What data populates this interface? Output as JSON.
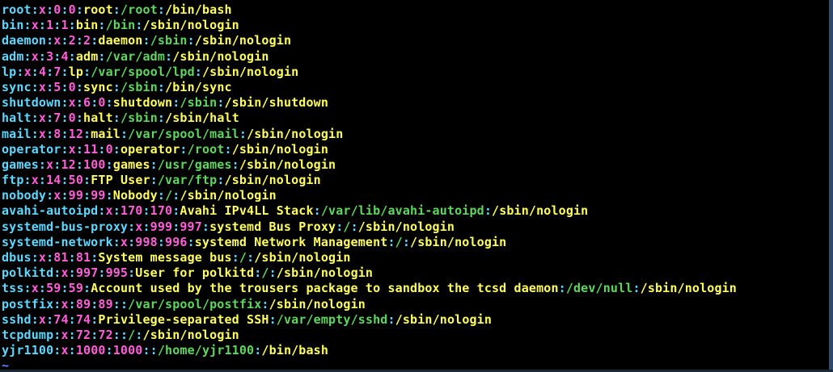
{
  "colors": {
    "background": "#000000",
    "field_user": "#5fd7ff",
    "field_x": "#ff5fd7",
    "field_uid": "#ff5fd7",
    "field_gid": "#ff5fd7",
    "field_gecos": "#ffff5f",
    "field_home": "#5fd75f",
    "field_shell": "#ffff5f",
    "separator": "#5fd7ff",
    "tilde": "#5f87ff"
  },
  "terminal": {
    "lines": [
      [
        "root",
        "x",
        "0",
        "0",
        "root",
        "/root",
        "/bin/bash"
      ],
      [
        "bin",
        "x",
        "1",
        "1",
        "bin",
        "/bin",
        "/sbin/nologin"
      ],
      [
        "daemon",
        "x",
        "2",
        "2",
        "daemon",
        "/sbin",
        "/sbin/nologin"
      ],
      [
        "adm",
        "x",
        "3",
        "4",
        "adm",
        "/var/adm",
        "/sbin/nologin"
      ],
      [
        "lp",
        "x",
        "4",
        "7",
        "lp",
        "/var/spool/lpd",
        "/sbin/nologin"
      ],
      [
        "sync",
        "x",
        "5",
        "0",
        "sync",
        "/sbin",
        "/bin/sync"
      ],
      [
        "shutdown",
        "x",
        "6",
        "0",
        "shutdown",
        "/sbin",
        "/sbin/shutdown"
      ],
      [
        "halt",
        "x",
        "7",
        "0",
        "halt",
        "/sbin",
        "/sbin/halt"
      ],
      [
        "mail",
        "x",
        "8",
        "12",
        "mail",
        "/var/spool/mail",
        "/sbin/nologin"
      ],
      [
        "operator",
        "x",
        "11",
        "0",
        "operator",
        "/root",
        "/sbin/nologin"
      ],
      [
        "games",
        "x",
        "12",
        "100",
        "games",
        "/usr/games",
        "/sbin/nologin"
      ],
      [
        "ftp",
        "x",
        "14",
        "50",
        "FTP User",
        "/var/ftp",
        "/sbin/nologin"
      ],
      [
        "nobody",
        "x",
        "99",
        "99",
        "Nobody",
        "/",
        "/sbin/nologin"
      ],
      [
        "avahi-autoipd",
        "x",
        "170",
        "170",
        "Avahi IPv4LL Stack",
        "/var/lib/avahi-autoipd",
        "/sbin/nologin"
      ],
      [
        "systemd-bus-proxy",
        "x",
        "999",
        "997",
        "systemd Bus Proxy",
        "/",
        "/sbin/nologin"
      ],
      [
        "systemd-network",
        "x",
        "998",
        "996",
        "systemd Network Management",
        "/",
        "/sbin/nologin"
      ],
      [
        "dbus",
        "x",
        "81",
        "81",
        "System message bus",
        "/",
        "/sbin/nologin"
      ],
      [
        "polkitd",
        "x",
        "997",
        "995",
        "User for polkitd",
        "/",
        "/sbin/nologin"
      ],
      [
        "tss",
        "x",
        "59",
        "59",
        "Account used by the trousers package to sandbox the tcsd daemon",
        "/dev/null",
        "/sbin/nologin"
      ],
      [
        "postfix",
        "x",
        "89",
        "89",
        "",
        "/var/spool/postfix",
        "/sbin/nologin"
      ],
      [
        "sshd",
        "x",
        "74",
        "74",
        "Privilege-separated SSH",
        "/var/empty/sshd",
        "/sbin/nologin"
      ],
      [
        "tcpdump",
        "x",
        "72",
        "72",
        "",
        "/",
        "/sbin/nologin"
      ],
      [
        "yjr1100",
        "x",
        "1000",
        "1000",
        "",
        "/home/yjr1100",
        "/bin/bash"
      ]
    ],
    "empty_line_marker": "~"
  }
}
